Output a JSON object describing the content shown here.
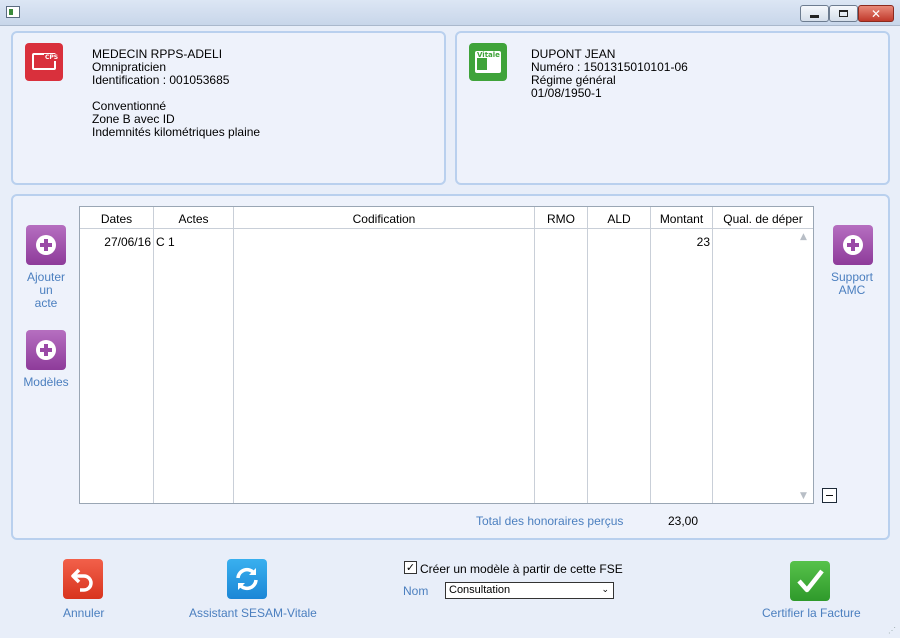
{
  "window": {
    "icon": "app-icon",
    "controls": [
      "minimize-icon",
      "maximize-icon",
      "close-icon"
    ]
  },
  "practitioner": {
    "icon": "cps-card-icon",
    "icon_tag": "CPS",
    "name": "MEDECIN RPPS-ADELI",
    "specialty": "Omnipraticien",
    "identification": "Identification : 001053685",
    "convention": "Conventionné",
    "zone": "Zone B avec ID",
    "indemnities": "Indemnités kilométriques plaine"
  },
  "patient": {
    "icon": "vitale-card-icon",
    "icon_tag": "Vitale",
    "name": "DUPONT JEAN",
    "number": "Numéro : 1501315010101-06",
    "regime": "Régime général",
    "birthdate": "01/08/1950-1"
  },
  "side_left": {
    "add_act_label": [
      "Ajouter",
      "un",
      "acte"
    ],
    "models_label": "Modèles"
  },
  "side_right": {
    "support_label": [
      "Support",
      "AMC"
    ]
  },
  "table": {
    "headers": [
      "Dates",
      "Actes",
      "Codification",
      "RMO",
      "ALD",
      "Montant",
      "Qual. de déper"
    ],
    "rows": [
      {
        "date": "27/06/16",
        "acte": "C 1",
        "codification": "",
        "rmo": "",
        "ald": "",
        "montant": "23",
        "qual": ""
      }
    ]
  },
  "totals": {
    "label": "Total des honoraires perçus",
    "value": "23,00"
  },
  "footer": {
    "annuler": "Annuler",
    "assistant": "Assistant SESAM-Vitale",
    "checkbox_label": "Créer un modèle à partir de cette FSE",
    "checkbox_checked": true,
    "nom_label": "Nom",
    "nom_value": "Consultation",
    "certifier": "Certifier la Facture"
  },
  "colors": {
    "accent_text": "#4b7fbf",
    "panel_border": "#b9d0ee",
    "purple_button": "#9a4aa6",
    "cps_red": "#d9303c",
    "vitale_green": "#3fa33a"
  }
}
